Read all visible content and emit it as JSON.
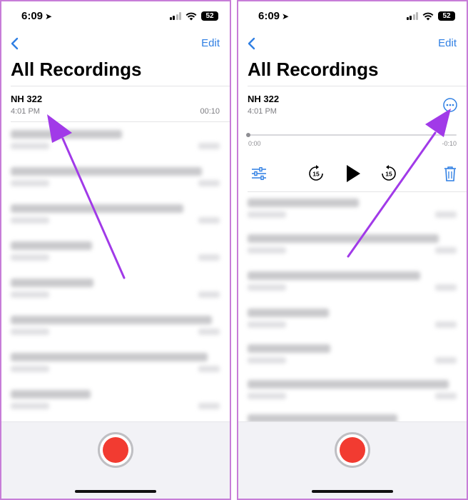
{
  "colors": {
    "accent": "#2f7fe3",
    "record": "#f23b31",
    "annotation_arrow": "#a13ae8",
    "panel_border": "#c77dd8"
  },
  "left_screen": {
    "status_bar": {
      "time": "6:09",
      "battery": "52"
    },
    "nav": {
      "back_icon": "chevron-left-icon",
      "edit_label": "Edit"
    },
    "title": "All Recordings",
    "selected_recording": {
      "name": "NH 322",
      "time": "4:01 PM",
      "duration": "00:10"
    },
    "blurred_rows": 8
  },
  "right_screen": {
    "status_bar": {
      "time": "6:09",
      "battery": "52"
    },
    "nav": {
      "back_icon": "chevron-left-icon",
      "edit_label": "Edit"
    },
    "title": "All Recordings",
    "selected_recording": {
      "name": "NH 322",
      "time": "4:01 PM"
    },
    "playback": {
      "current_time": "0:00",
      "remaining_time": "-0:10",
      "progress": 0.0,
      "icons": [
        "sliders-icon",
        "skip-back-15-icon",
        "play-icon",
        "skip-forward-15-icon",
        "trash-icon",
        "more-options-icon"
      ]
    },
    "blurred_rows": 7
  }
}
